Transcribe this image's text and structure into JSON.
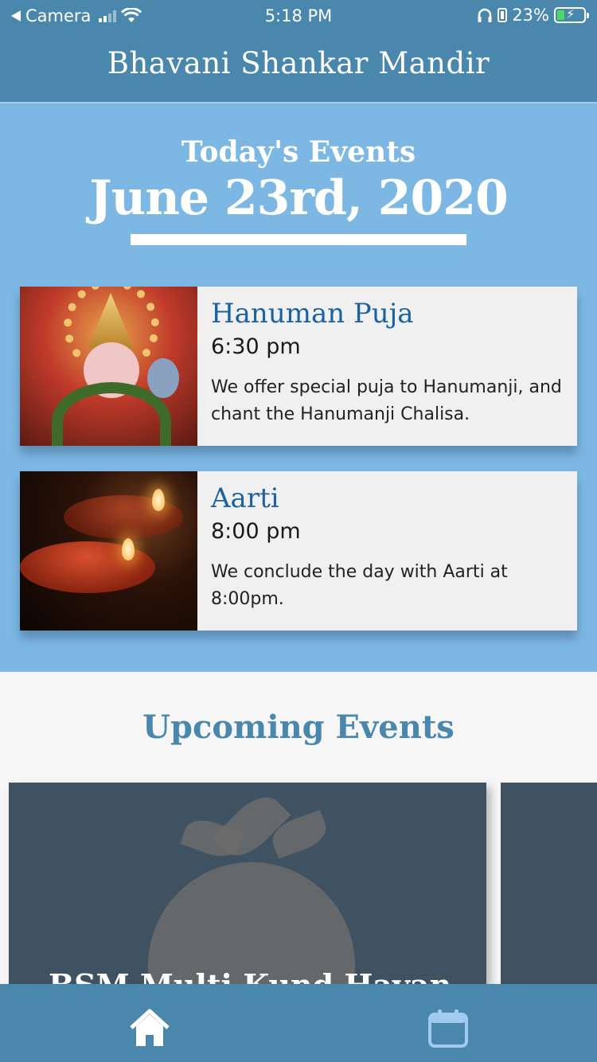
{
  "status_bar": {
    "back_app": "Camera",
    "time": "5:18 PM",
    "battery": "23%"
  },
  "header": {
    "title": "Bhavani Shankar Mandir"
  },
  "today": {
    "label": "Today's Events",
    "date": "June 23rd, 2020",
    "events": [
      {
        "name": "Hanuman Puja",
        "time": "6:30 pm",
        "description": "We offer special puja to Hanumanji, and chant the Hanumanji Chalisa."
      },
      {
        "name": "Aarti",
        "time": "8:00 pm",
        "description": "We conclude the day with Aarti at 8:00pm."
      }
    ]
  },
  "upcoming": {
    "title": "Upcoming Events",
    "cards": [
      {
        "title": "BSM Multi Kund Havan"
      }
    ]
  },
  "bottom_nav": {
    "items": [
      {
        "icon": "home-icon",
        "active": true
      },
      {
        "icon": "calendar-icon",
        "active": false
      }
    ]
  },
  "colors": {
    "header_bg": "#4a87ad",
    "today_bg": "#7db8e4",
    "event_name": "#1c61a0",
    "card_bg": "#3f5261"
  }
}
